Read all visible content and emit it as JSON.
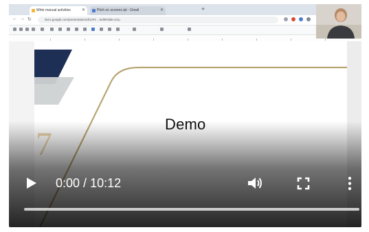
{
  "browser": {
    "tabs": [
      {
        "title": "Write manual activities",
        "active": true
      },
      {
        "title": "Pitch on screens ipt - Gmail",
        "active": false
      }
    ],
    "url": "docs.google.com/presentation/d/1vPz…/edit#slide=id.p"
  },
  "slide": {
    "title": "Demo",
    "colors": {
      "navy": "#1d2f55",
      "gray": "#cfd2d3",
      "gold": "#b8a572"
    }
  },
  "player": {
    "time": {
      "current": "0:00",
      "separator": " / ",
      "duration": "10:12"
    },
    "progress": 0.0,
    "icons": {
      "play": "play-icon",
      "volume": "volume-icon",
      "fullscreen": "fullscreen-icon",
      "more": "more-vert-icon"
    }
  }
}
